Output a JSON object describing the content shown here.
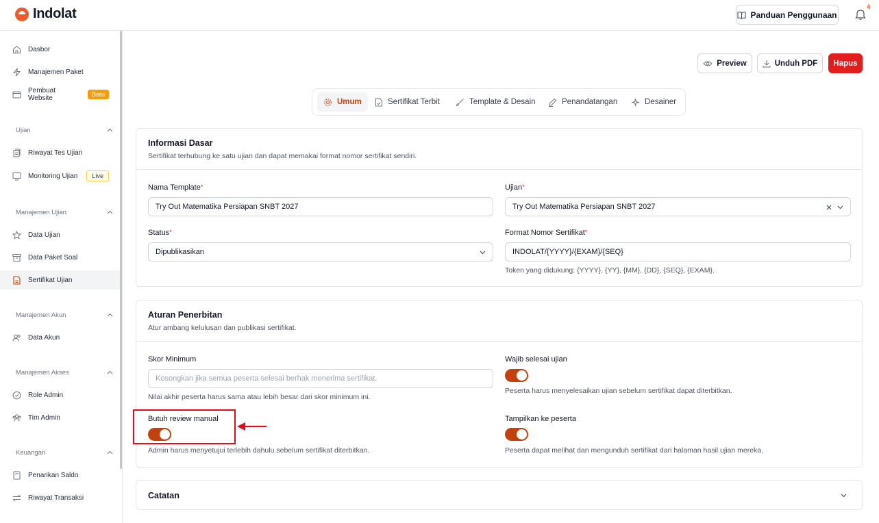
{
  "app": {
    "name": "Indolat"
  },
  "header": {
    "guide_label": "Panduan Penggunaan",
    "notif_count": "4"
  },
  "sidebar": {
    "items_top": [
      {
        "label": "Dasbor",
        "icon": "home-icon"
      },
      {
        "label": "Manajemen Paket",
        "icon": "zap-icon"
      },
      {
        "label": "Pembuat Website",
        "icon": "browser-icon",
        "badge": "Baru"
      }
    ],
    "section_ujian": "Ujian",
    "items_ujian": [
      {
        "label": "Riwayat Tes Ujian",
        "icon": "history-icon"
      },
      {
        "label": "Monitoring Ujian",
        "icon": "monitor-icon",
        "badge": "Live"
      }
    ],
    "section_manajemen_ujian": "Manajemen Ujian",
    "items_manajemen_ujian": [
      {
        "label": "Data Ujian",
        "icon": "star-icon"
      },
      {
        "label": "Data Paket Soal",
        "icon": "archive-icon"
      },
      {
        "label": "Sertifikat Ujian",
        "icon": "certificate-icon"
      }
    ],
    "section_manajemen_akun": "Manajemen Akun",
    "items_manajemen_akun": [
      {
        "label": "Data Akun",
        "icon": "users-icon"
      }
    ],
    "section_manajemen_akses": "Manajemen Akses",
    "items_manajemen_akses": [
      {
        "label": "Role Admin",
        "icon": "shield-check-icon"
      },
      {
        "label": "Tim Admin",
        "icon": "team-icon"
      }
    ],
    "section_keuangan": "Keuangan",
    "items_keuangan": [
      {
        "label": "Penarikan Saldo",
        "icon": "wallet-icon"
      },
      {
        "label": "Riwayat Transaksi",
        "icon": "transfer-icon"
      }
    ]
  },
  "actions": {
    "preview": "Preview",
    "download": "Unduh PDF",
    "delete": "Hapus"
  },
  "tabs": [
    {
      "label": "Umum",
      "icon": "gear-icon",
      "active": true
    },
    {
      "label": "Sertifikat Terbit",
      "icon": "file-check-icon"
    },
    {
      "label": "Template & Desain",
      "icon": "brush-icon"
    },
    {
      "label": "Penandatangan",
      "icon": "pen-icon"
    },
    {
      "label": "Desainer",
      "icon": "sparkle-icon"
    }
  ],
  "info": {
    "title": "Informasi Dasar",
    "subtitle": "Sertifikat terhubung ke satu ujian dan dapat memakai format nomor sertifikat sendiri.",
    "name_label": "Nama Template",
    "name_value": "Try Out Matematika Persiapan SNBT 2027",
    "exam_label": "Ujian",
    "exam_value": "Try Out Matematika Persiapan SNBT 2027",
    "status_label": "Status",
    "status_value": "Dipublikasikan",
    "format_label": "Format Nomor Sertifikat",
    "format_value": "INDOLAT/{YYYY}/{EXAM}/{SEQ}",
    "format_help": "Token yang didukung: {YYYY}, {YY}, {MM}, {DD}, {SEQ}, {EXAM}.",
    "required_mark": "*"
  },
  "rules": {
    "title": "Aturan Penerbitan",
    "subtitle": "Atur ambang kelulusan dan publikasi sertifikat.",
    "min_score_label": "Skor Minimum",
    "min_score_placeholder": "Kosongkan jika semua peserta selesai berhak menerima sertifikat.",
    "min_score_help": "Nilai akhir peserta harus sama atau lebih besar dari skor minimum ini.",
    "must_finish_label": "Wajib selesai ujian",
    "must_finish_on": true,
    "must_finish_help": "Peserta harus menyelesaikan ujian sebelum sertifikat dapat diterbitkan.",
    "manual_review_label": "Butuh review manual",
    "manual_review_on": true,
    "manual_review_help": "Admin harus menyetujui terlebih dahulu sebelum sertifikat diterbitkan.",
    "show_label": "Tampilkan ke peserta",
    "show_on": true,
    "show_help": "Peserta dapat melihat dan mengunduh sertifikat dari halaman hasil ujian mereka."
  },
  "notes": {
    "title": "Catatan"
  },
  "colors": {
    "accent": "#c2410c",
    "brand": "#f05a28",
    "danger": "#e11d1d",
    "highlight": "#e5091c"
  }
}
